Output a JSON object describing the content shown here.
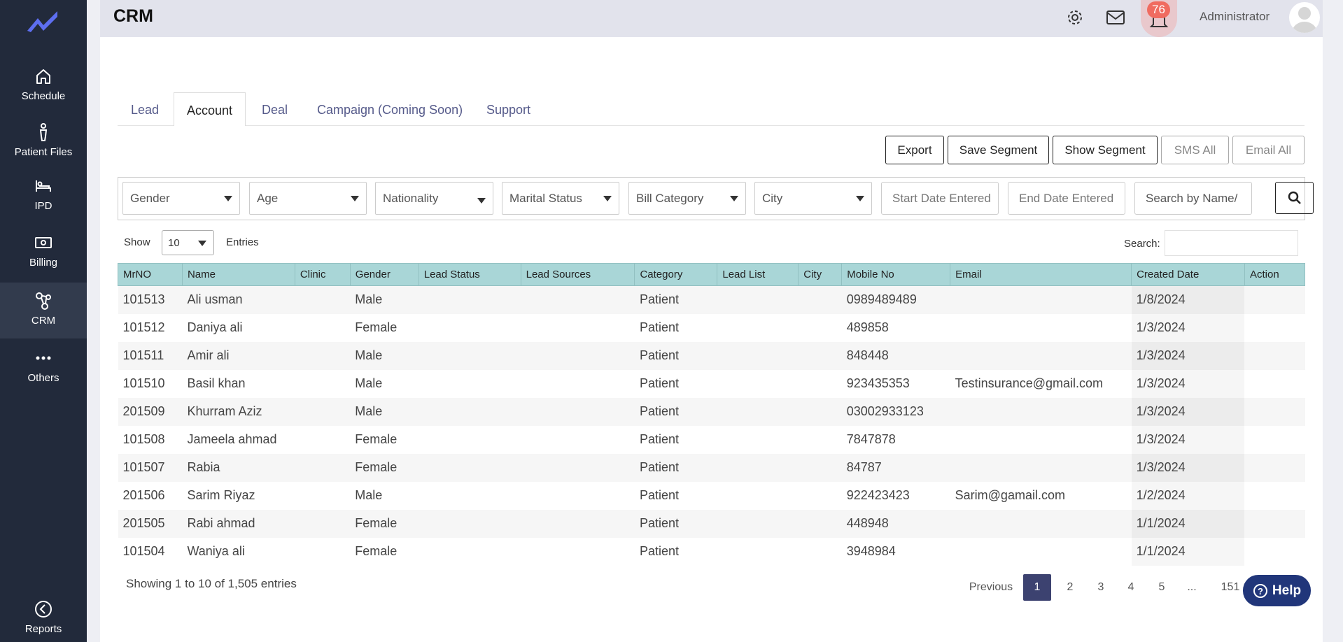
{
  "app": {
    "title": "CRM"
  },
  "sidebar": {
    "items": [
      {
        "label": "Schedule",
        "icon": "home-icon"
      },
      {
        "label": "Patient Files",
        "icon": "person-icon"
      },
      {
        "label": "IPD",
        "icon": "bed-icon"
      },
      {
        "label": "Billing",
        "icon": "money-icon"
      },
      {
        "label": "CRM",
        "icon": "crm-icon",
        "active": true
      },
      {
        "label": "Others",
        "icon": "more-icon"
      },
      {
        "label": "Reports",
        "icon": "back-icon"
      }
    ]
  },
  "header": {
    "notification_count": "76",
    "user_name": "Administrator"
  },
  "tabs": [
    {
      "label": "Lead"
    },
    {
      "label": "Account",
      "active": true
    },
    {
      "label": "Deal"
    },
    {
      "label": "Campaign (Coming Soon)"
    },
    {
      "label": "Support"
    }
  ],
  "actions": {
    "export": "Export",
    "save_segment": "Save Segment",
    "show_segment": "Show Segment",
    "sms_all": "SMS All",
    "email_all": "Email All"
  },
  "filters": {
    "gender": "Gender",
    "age": "Age",
    "nationality": "Nationality",
    "marital_status": "Marital Status",
    "bill_category": "Bill Category",
    "city": "City",
    "start_date_placeholder": "Start Date Entered",
    "end_date_placeholder": "End Date Entered",
    "search_placeholder": "Search by Name/"
  },
  "table_controls": {
    "show_label": "Show",
    "page_size": "10",
    "entries_label": "Entries",
    "search_label": "Search:"
  },
  "table": {
    "columns": [
      "MrNO",
      "Name",
      "Clinic",
      "Gender",
      "Lead Status",
      "Lead Sources",
      "Category",
      "Lead List",
      "City",
      "Mobile No",
      "Email",
      "Created Date",
      "Action"
    ],
    "rows": [
      [
        "101513",
        "Ali usman",
        "",
        "Male",
        "",
        "",
        "Patient",
        "",
        "",
        "0989489489",
        "",
        "1/8/2024",
        ""
      ],
      [
        "101512",
        "Daniya ali",
        "",
        "Female",
        "",
        "",
        "Patient",
        "",
        "",
        "489858",
        "",
        "1/3/2024",
        ""
      ],
      [
        "101511",
        "Amir ali",
        "",
        "Male",
        "",
        "",
        "Patient",
        "",
        "",
        "848448",
        "",
        "1/3/2024",
        ""
      ],
      [
        "101510",
        "Basil khan",
        "",
        "Male",
        "",
        "",
        "Patient",
        "",
        "",
        "923435353",
        "Testinsurance@gmail.com",
        "1/3/2024",
        ""
      ],
      [
        "201509",
        "Khurram Aziz",
        "",
        "Male",
        "",
        "",
        "Patient",
        "",
        "",
        "03002933123",
        "",
        "1/3/2024",
        ""
      ],
      [
        "101508",
        "Jameela ahmad",
        "",
        "Female",
        "",
        "",
        "Patient",
        "",
        "",
        "7847878",
        "",
        "1/3/2024",
        ""
      ],
      [
        "101507",
        "Rabia",
        "",
        "Female",
        "",
        "",
        "Patient",
        "",
        "",
        "84787",
        "",
        "1/3/2024",
        ""
      ],
      [
        "201506",
        "Sarim Riyaz",
        "",
        "Male",
        "",
        "",
        "Patient",
        "",
        "",
        "922423423",
        "Sarim@gamail.com",
        "1/2/2024",
        ""
      ],
      [
        "201505",
        "Rabi ahmad",
        "",
        "Female",
        "",
        "",
        "Patient",
        "",
        "",
        "448948",
        "",
        "1/1/2024",
        ""
      ],
      [
        "101504",
        "Waniya ali",
        "",
        "Female",
        "",
        "",
        "Patient",
        "",
        "",
        "3948984",
        "",
        "1/1/2024",
        ""
      ]
    ]
  },
  "pagination": {
    "info": "Showing 1 to 10 of 1,505 entries",
    "previous": "Previous",
    "pages": [
      "1",
      "2",
      "3",
      "4",
      "5",
      "...",
      "151"
    ],
    "current": "1"
  },
  "help": {
    "label": "Help"
  }
}
